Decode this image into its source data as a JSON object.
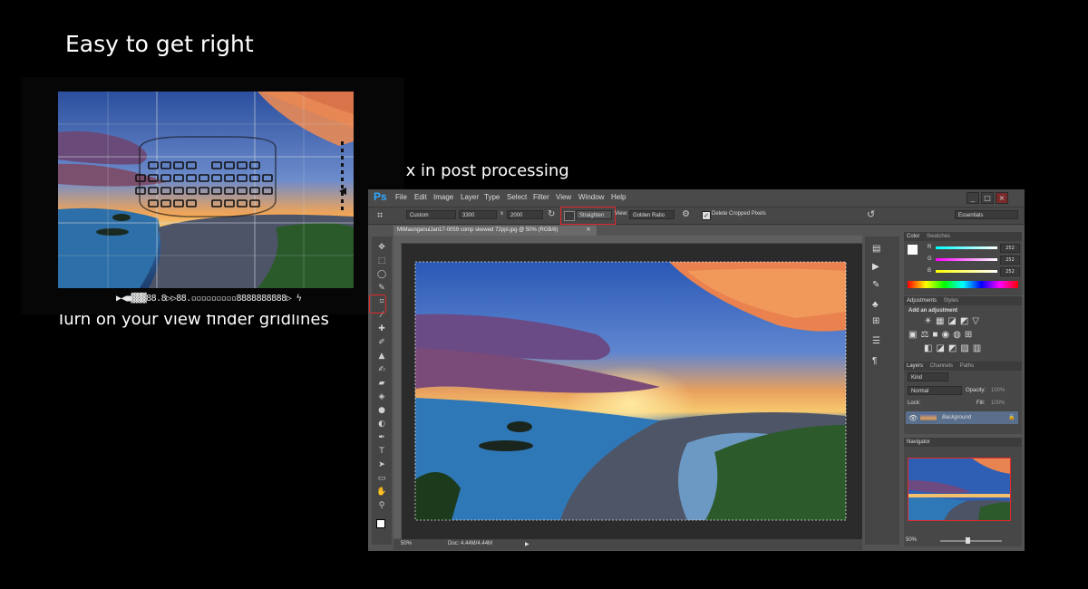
{
  "slide": {
    "title": "Easy to get right",
    "subtitle_post": "Or fix in post processing",
    "caption": "Turn on your view finder gridlines"
  },
  "viewfinder": {
    "status_readout": "▶◀■▓▓▓88.8▷▷88.▫▫▫▫▫▫▫▫▫8888888888▷ ϟ"
  },
  "photoshop": {
    "logo": "Ps",
    "menu": [
      "File",
      "Edit",
      "Image",
      "Layer",
      "Type",
      "Select",
      "Filter",
      "View",
      "Window",
      "Help"
    ],
    "window_controls": [
      "_",
      "□",
      "×"
    ],
    "options": {
      "preset": "Custom",
      "width": "3300",
      "x_label": "x",
      "height": "2000",
      "straighten_label": "Straighten",
      "view_label": "View:",
      "overlay": "Golden Ratio",
      "delete_cropped": "Delete Cropped Pixels",
      "workspace": "Essentials"
    },
    "document_tab": "MtMaunganuiJan17-0059 comp skewed 72ppi.jpg @ 50% (RGB/8)",
    "status": {
      "zoom": "50%",
      "doc": "Doc: 4.44M/4.44M"
    },
    "color_panel": {
      "tabs": [
        "Color",
        "Swatches"
      ],
      "channels": [
        {
          "label": "R",
          "value": "252",
          "gradient": "#00ffff"
        },
        {
          "label": "G",
          "value": "252",
          "gradient": "#ff00ff"
        },
        {
          "label": "B",
          "value": "252",
          "gradient": "#ffff00"
        }
      ]
    },
    "adjustments_panel": {
      "tabs": [
        "Adjustments",
        "Styles"
      ],
      "heading": "Add an adjustment"
    },
    "layers_panel": {
      "tabs": [
        "Layers",
        "Channels",
        "Paths"
      ],
      "kind": "Kind",
      "blend_mode": "Normal",
      "opacity_label": "Opacity:",
      "opacity_value": "100%",
      "lock_label": "Lock:",
      "fill_label": "Fill:",
      "fill_value": "100%",
      "layer_name": "Background"
    },
    "navigator_panel": {
      "title": "Navigator",
      "zoom": "50%"
    }
  },
  "colors": {
    "highlight_red": "#e3262a",
    "ps_blue": "#31a8ff",
    "ui_dark": "#535353"
  }
}
